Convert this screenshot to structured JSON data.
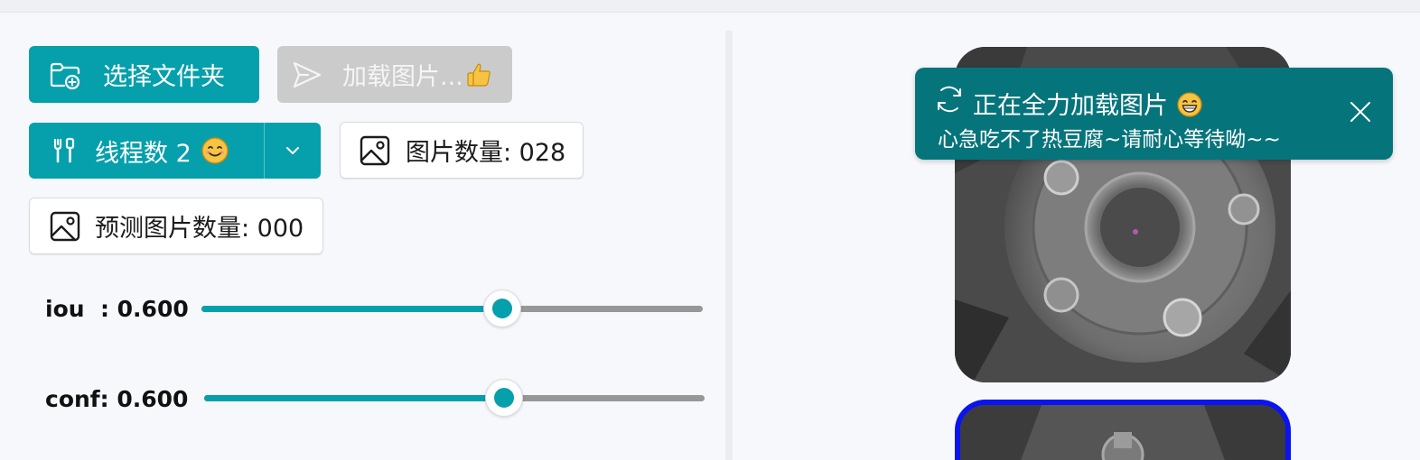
{
  "toolbar": {
    "select_folder_label": "选择文件夹",
    "load_images_label": "加载图片...",
    "thread_count_label": "线程数 2",
    "image_count_label": "图片数量: 028",
    "predicted_count_label": "预测图片数量: 000"
  },
  "sliders": {
    "iou": {
      "label": "iou  : 0.600",
      "value": 0.6,
      "min": 0,
      "max": 1
    },
    "conf": {
      "label": "conf: 0.600",
      "value": 0.6,
      "min": 0,
      "max": 1
    }
  },
  "toast": {
    "title": "正在全力加载图片",
    "message": "心急吃不了热豆腐~请耐心等待呦~~"
  },
  "icons": {
    "folder": "folder-add-icon",
    "send": "send-icon",
    "thumbs_up": "thumbs-up-emoji",
    "tools": "tools-icon",
    "smile": "smile-emoji",
    "chevron": "chevron-down-icon",
    "image": "image-icon",
    "sync": "sync-icon",
    "grin": "grin-emoji",
    "close": "close-icon"
  },
  "colors": {
    "accent": "#05a0ab",
    "toast_bg": "#06747b",
    "disabled": "#cbcbcb",
    "selected_border": "#0a14f0"
  }
}
